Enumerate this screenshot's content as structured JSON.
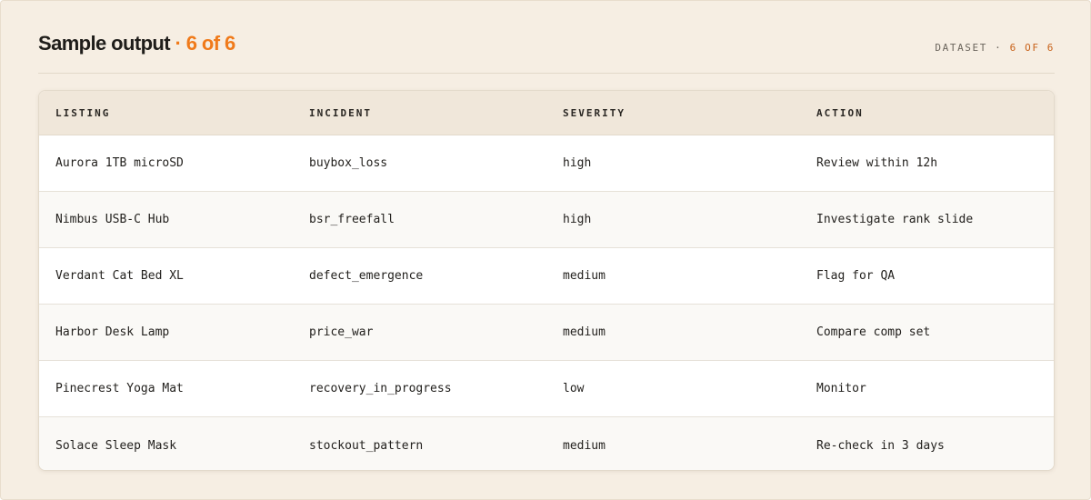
{
  "header": {
    "title": "Sample output",
    "title_accent": "· 6 of 6",
    "dataset_label": "DATASET ·",
    "dataset_count": "6 OF 6"
  },
  "table": {
    "columns": [
      "LISTING",
      "INCIDENT",
      "SEVERITY",
      "ACTION"
    ],
    "rows": [
      {
        "listing": "Aurora 1TB microSD",
        "incident": "buybox_loss",
        "severity": "high",
        "action": "Review within 12h"
      },
      {
        "listing": "Nimbus USB-C Hub",
        "incident": "bsr_freefall",
        "severity": "high",
        "action": "Investigate rank slide"
      },
      {
        "listing": "Verdant Cat Bed XL",
        "incident": "defect_emergence",
        "severity": "medium",
        "action": "Flag for QA"
      },
      {
        "listing": "Harbor Desk Lamp",
        "incident": "price_war",
        "severity": "medium",
        "action": "Compare comp set"
      },
      {
        "listing": "Pinecrest Yoga Mat",
        "incident": "recovery_in_progress",
        "severity": "low",
        "action": "Monitor"
      },
      {
        "listing": "Solace Sleep Mask",
        "incident": "stockout_pattern",
        "severity": "medium",
        "action": "Re-check in 3 days"
      }
    ]
  },
  "colors": {
    "accent": "#f07a1a",
    "background": "#f6eee3",
    "header_row": "#f0e7da"
  }
}
